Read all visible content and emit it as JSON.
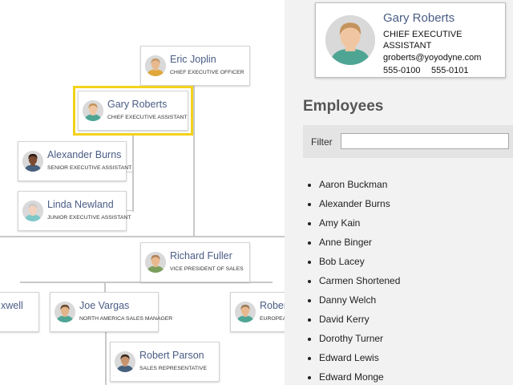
{
  "chart": {
    "nodes": [
      {
        "id": "eric",
        "name": "Eric Joplin",
        "title": "Chief Executive Officer",
        "skin": "#e8b98f",
        "hair": "#c49a6c",
        "shirt": "#e0a83a"
      },
      {
        "id": "gary",
        "name": "Gary Roberts",
        "title": "Chief Executive Assistant",
        "skin": "#f0c6a2",
        "hair": "#c4945e",
        "shirt": "#4fa594",
        "selected": true
      },
      {
        "id": "alex",
        "name": "Alexander Burns",
        "title": "Senior Executive Assistant",
        "skin": "#7a4a32",
        "hair": "#2a1a12",
        "shirt": "#46607e"
      },
      {
        "id": "linda",
        "name": "Linda Newland",
        "title": "Junior Executive Assistant",
        "skin": "#f2d2bd",
        "hair": "#c9c9c9",
        "shirt": "#7ec7c9"
      },
      {
        "id": "richard",
        "name": "Richard Fuller",
        "title": "Vice President of Sales",
        "skin": "#e8b98f",
        "hair": "#b0835a",
        "shirt": "#7a9e5c"
      },
      {
        "id": "joe",
        "name": "Joe Vargas",
        "title": "North America Sales Manager",
        "skin": "#e2b48a",
        "hair": "#6a4a30",
        "shirt": "#4fa594"
      },
      {
        "id": "robert",
        "name": "Robert Parson",
        "title": "Sales Representative",
        "skin": "#c89470",
        "hair": "#3a2a20",
        "shirt": "#46607e"
      },
      {
        "id": "left",
        "name": "xwell",
        "title": "",
        "skin": "#e8b98f",
        "hair": "#9a7a5a",
        "shirt": "#4fa594"
      },
      {
        "id": "right",
        "name": "Rober",
        "title": "Europea Manage",
        "skin": "#e8b98f",
        "hair": "#9a7a5a",
        "shirt": "#4fa594"
      }
    ]
  },
  "card": {
    "name": "Gary Roberts",
    "title": "Chief Executive Assistant",
    "email": "groberts@yoyodyne.com",
    "phone1": "555-0100",
    "phone2": "555-0101",
    "skin": "#f0c6a2",
    "hair": "#c4945e",
    "shirt": "#4fa594"
  },
  "employees": {
    "heading": "Employees",
    "filter_label": "Filter",
    "filter_value": "",
    "items": [
      "Aaron Buckman",
      "Alexander Burns",
      "Amy Kain",
      "Anne Binger",
      "Bob Lacey",
      "Carmen Shortened",
      "Danny Welch",
      "David Kerry",
      "Dorothy Turner",
      "Edward Lewis",
      "Edward Monge"
    ]
  }
}
